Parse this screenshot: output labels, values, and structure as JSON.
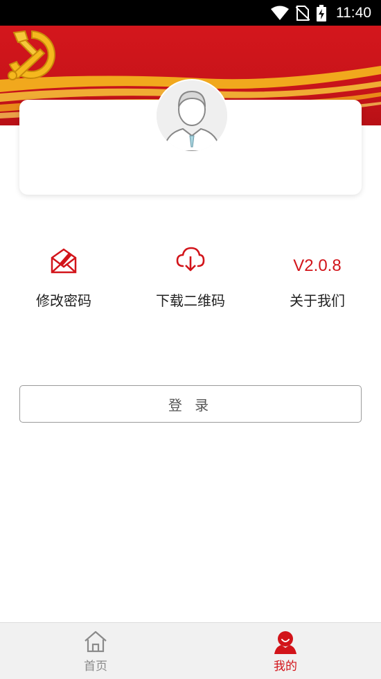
{
  "status_bar": {
    "time": "11:40",
    "icons": [
      "wifi-icon",
      "no-sim-icon",
      "battery-charging-icon"
    ]
  },
  "profile": {
    "avatar_icon": "user-avatar-icon"
  },
  "menu": [
    {
      "id": "change_password",
      "icon": "envelope-edit-icon",
      "label": "修改密码"
    },
    {
      "id": "download_qr",
      "icon": "cloud-download-icon",
      "label": "下载二维码"
    },
    {
      "id": "about",
      "version": "V2.0.8",
      "label": "关于我们"
    }
  ],
  "login": {
    "label": "登 录"
  },
  "bottom_nav": [
    {
      "id": "home",
      "icon": "home-icon",
      "label": "首页",
      "active": false
    },
    {
      "id": "mine",
      "icon": "profile-icon",
      "label": "我的",
      "active": true
    }
  ],
  "colors": {
    "brand_red": "#d2141a",
    "gold": "#f5b81e",
    "inactive_gray": "#8a8a8a"
  }
}
